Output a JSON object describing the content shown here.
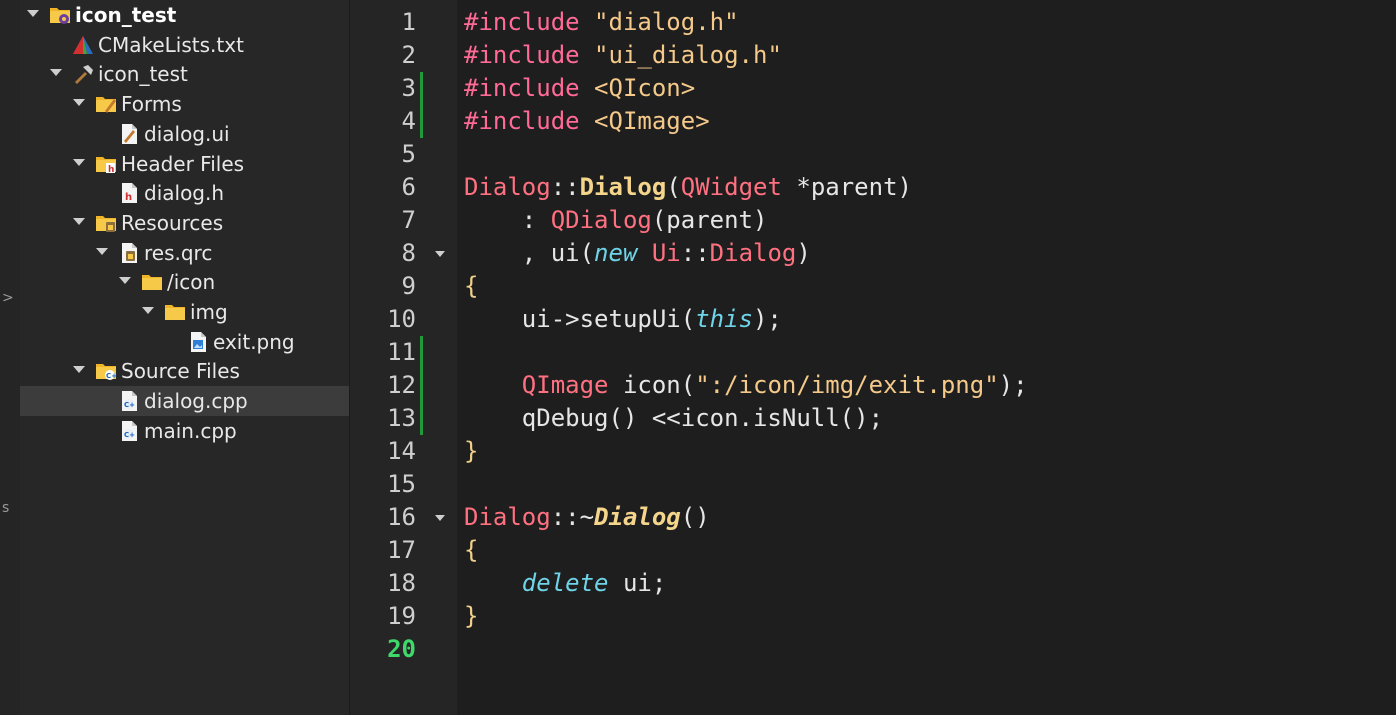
{
  "project_tree": {
    "items": [
      {
        "label": "icon_test",
        "depth": 0,
        "expanded": true,
        "icon": "project-folder-gear-icon",
        "bold": true,
        "selected": false
      },
      {
        "label": "CMakeLists.txt",
        "depth": 1,
        "expanded": null,
        "icon": "cmake-icon",
        "bold": false,
        "selected": false
      },
      {
        "label": "icon_test",
        "depth": 1,
        "expanded": true,
        "icon": "hammer-icon",
        "bold": false,
        "selected": false
      },
      {
        "label": "Forms",
        "depth": 2,
        "expanded": true,
        "icon": "forms-folder-icon",
        "bold": false,
        "selected": false
      },
      {
        "label": "dialog.ui",
        "depth": 3,
        "expanded": null,
        "icon": "ui-file-icon",
        "bold": false,
        "selected": false
      },
      {
        "label": "Header Files",
        "depth": 2,
        "expanded": true,
        "icon": "header-folder-icon",
        "bold": false,
        "selected": false
      },
      {
        "label": "dialog.h",
        "depth": 3,
        "expanded": null,
        "icon": "header-file-icon",
        "bold": false,
        "selected": false
      },
      {
        "label": "Resources",
        "depth": 2,
        "expanded": true,
        "icon": "resources-folder-icon",
        "bold": false,
        "selected": false
      },
      {
        "label": "res.qrc",
        "depth": 3,
        "expanded": true,
        "icon": "qrc-file-icon",
        "bold": false,
        "selected": false
      },
      {
        "label": "/icon",
        "depth": 4,
        "expanded": true,
        "icon": "folder-icon",
        "bold": false,
        "selected": false
      },
      {
        "label": "img",
        "depth": 5,
        "expanded": true,
        "icon": "folder-icon",
        "bold": false,
        "selected": false
      },
      {
        "label": "exit.png",
        "depth": 6,
        "expanded": null,
        "icon": "image-file-icon",
        "bold": false,
        "selected": false
      },
      {
        "label": "Source Files",
        "depth": 2,
        "expanded": true,
        "icon": "source-folder-icon",
        "bold": false,
        "selected": false
      },
      {
        "label": "dialog.cpp",
        "depth": 3,
        "expanded": null,
        "icon": "cpp-file-icon",
        "bold": false,
        "selected": true
      },
      {
        "label": "main.cpp",
        "depth": 3,
        "expanded": null,
        "icon": "cpp-file-icon",
        "bold": false,
        "selected": false
      }
    ]
  },
  "side_strip": {
    "marks": [
      ">",
      "s"
    ]
  },
  "editor": {
    "current_line": 20,
    "changed_lines": [
      3,
      4,
      11,
      12,
      13
    ],
    "foldable_lines": [
      8,
      16
    ],
    "lines": [
      {
        "n": "1",
        "tokens": [
          [
            "pre",
            "#include"
          ],
          [
            "p",
            " "
          ],
          [
            "str",
            "\"dialog.h\""
          ]
        ]
      },
      {
        "n": "2",
        "tokens": [
          [
            "pre",
            "#include"
          ],
          [
            "p",
            " "
          ],
          [
            "str",
            "\"ui_dialog.h\""
          ]
        ]
      },
      {
        "n": "3",
        "tokens": [
          [
            "pre",
            "#include"
          ],
          [
            "p",
            " "
          ],
          [
            "str",
            "<QIcon>"
          ]
        ]
      },
      {
        "n": "4",
        "tokens": [
          [
            "pre",
            "#include"
          ],
          [
            "p",
            " "
          ],
          [
            "str",
            "<QImage>"
          ]
        ]
      },
      {
        "n": "5",
        "tokens": []
      },
      {
        "n": "6",
        "tokens": [
          [
            "type",
            "Dialog"
          ],
          [
            "p",
            "::"
          ],
          [
            "fn",
            "Dialog"
          ],
          [
            "p",
            "("
          ],
          [
            "type",
            "QWidget"
          ],
          [
            "p",
            " *parent)"
          ]
        ]
      },
      {
        "n": "7",
        "tokens": [
          [
            "p",
            "    : "
          ],
          [
            "type",
            "QDialog"
          ],
          [
            "p",
            "(parent)"
          ]
        ]
      },
      {
        "n": "8",
        "tokens": [
          [
            "p",
            "    , ui("
          ],
          [
            "kw",
            "new"
          ],
          [
            "p",
            " "
          ],
          [
            "type",
            "Ui"
          ],
          [
            "p",
            "::"
          ],
          [
            "type",
            "Dialog"
          ],
          [
            "p",
            ")"
          ]
        ]
      },
      {
        "n": "9",
        "tokens": [
          [
            "br",
            "{"
          ]
        ]
      },
      {
        "n": "10",
        "tokens": [
          [
            "p",
            "    ui->setupUi("
          ],
          [
            "kw",
            "this"
          ],
          [
            "p",
            ");"
          ]
        ]
      },
      {
        "n": "11",
        "tokens": []
      },
      {
        "n": "12",
        "tokens": [
          [
            "p",
            "    "
          ],
          [
            "type",
            "QImage"
          ],
          [
            "p",
            " icon("
          ],
          [
            "str",
            "\":/icon/img/exit.png\""
          ],
          [
            "p",
            ");"
          ]
        ]
      },
      {
        "n": "13",
        "tokens": [
          [
            "p",
            "    qDebug() <<icon.isNull();"
          ]
        ]
      },
      {
        "n": "14",
        "tokens": [
          [
            "br",
            "}"
          ]
        ]
      },
      {
        "n": "15",
        "tokens": []
      },
      {
        "n": "16",
        "tokens": [
          [
            "type",
            "Dialog"
          ],
          [
            "p",
            "::~"
          ],
          [
            "fni",
            "Dialog"
          ],
          [
            "p",
            "()"
          ]
        ]
      },
      {
        "n": "17",
        "tokens": [
          [
            "br",
            "{"
          ]
        ]
      },
      {
        "n": "18",
        "tokens": [
          [
            "p",
            "    "
          ],
          [
            "kw",
            "delete"
          ],
          [
            "p",
            " ui;"
          ]
        ]
      },
      {
        "n": "19",
        "tokens": [
          [
            "br",
            "}"
          ]
        ]
      },
      {
        "n": "20",
        "tokens": []
      }
    ]
  }
}
